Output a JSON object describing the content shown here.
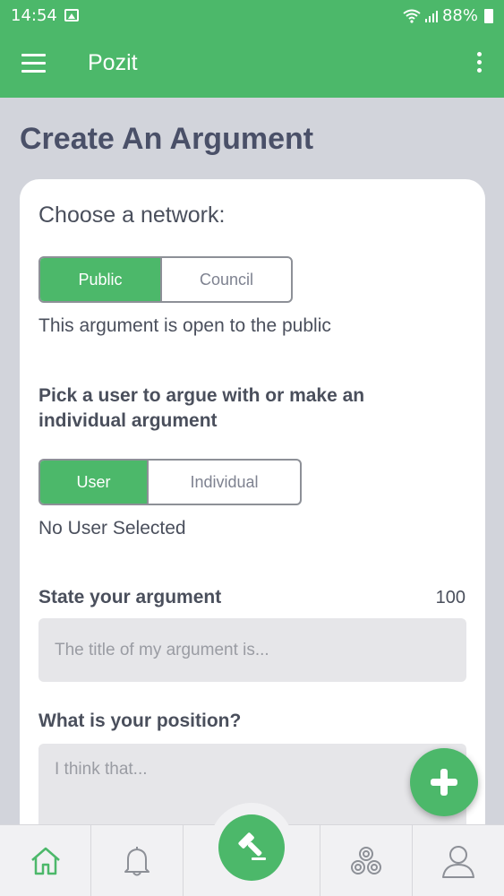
{
  "status_bar": {
    "time": "14:54",
    "battery": "88%"
  },
  "app_bar": {
    "title": "Pozit"
  },
  "page": {
    "title": "Create An Argument"
  },
  "network": {
    "heading": "Choose a network:",
    "options": [
      "Public",
      "Council"
    ],
    "selected": "Public",
    "description": "This argument is open to the public"
  },
  "opponent": {
    "heading": "Pick a user to argue with or make an individual argument",
    "options": [
      "User",
      "Individual"
    ],
    "selected": "User",
    "status": "No User Selected"
  },
  "argument": {
    "label": "State your argument",
    "counter": "100",
    "placeholder": "The title of my argument is..."
  },
  "position": {
    "label": "What is your position?",
    "placeholder": "I think that..."
  },
  "bottom_nav": {
    "items": [
      "home-icon",
      "bell-icon",
      "gavel-icon",
      "spiral-icon",
      "user-icon"
    ],
    "active": "home-icon"
  },
  "colors": {
    "brand": "#4cb86a",
    "text": "#4a4f5c",
    "title": "#4a5068"
  }
}
